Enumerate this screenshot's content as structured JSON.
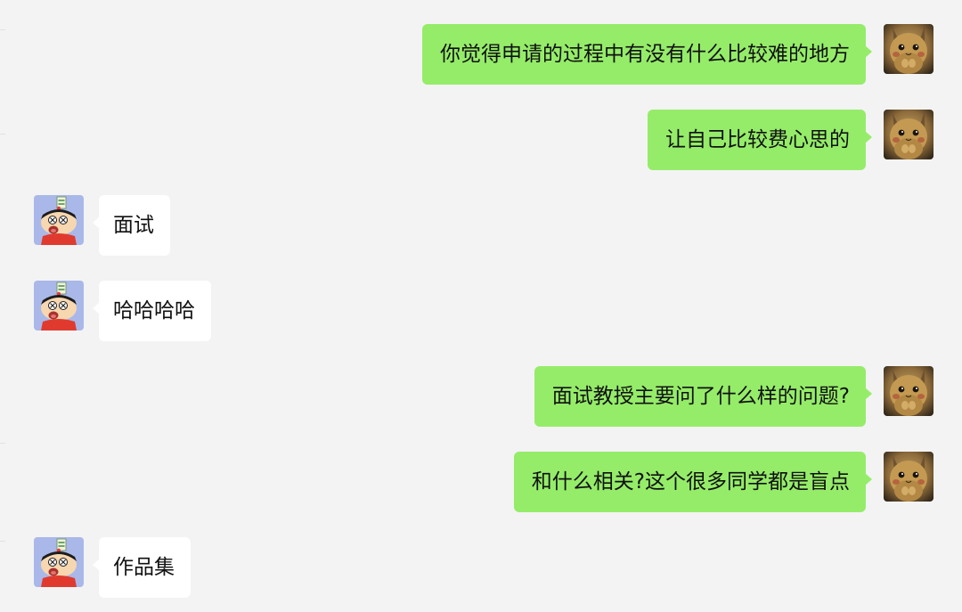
{
  "messages": [
    {
      "side": "out",
      "text": "你觉得申请的过程中有没有什么比较难的地方",
      "avatar": "pikachu-avatar"
    },
    {
      "side": "out",
      "text": "让自己比较费心思的",
      "avatar": "pikachu-avatar"
    },
    {
      "side": "in",
      "text": "面试",
      "avatar": "cartoon-boy-avatar"
    },
    {
      "side": "in",
      "text": "哈哈哈哈",
      "avatar": "cartoon-boy-avatar"
    },
    {
      "side": "out",
      "text": "面试教授主要问了什么样的问题?",
      "avatar": "pikachu-avatar"
    },
    {
      "side": "out",
      "text": "和什么相关?这个很多同学都是盲点",
      "avatar": "pikachu-avatar"
    },
    {
      "side": "in",
      "text": "作品集",
      "avatar": "cartoon-boy-avatar"
    }
  ],
  "colors": {
    "background": "#f3f3f3",
    "outgoing_bubble": "#95ec69",
    "incoming_bubble": "#ffffff",
    "text": "#111111"
  }
}
